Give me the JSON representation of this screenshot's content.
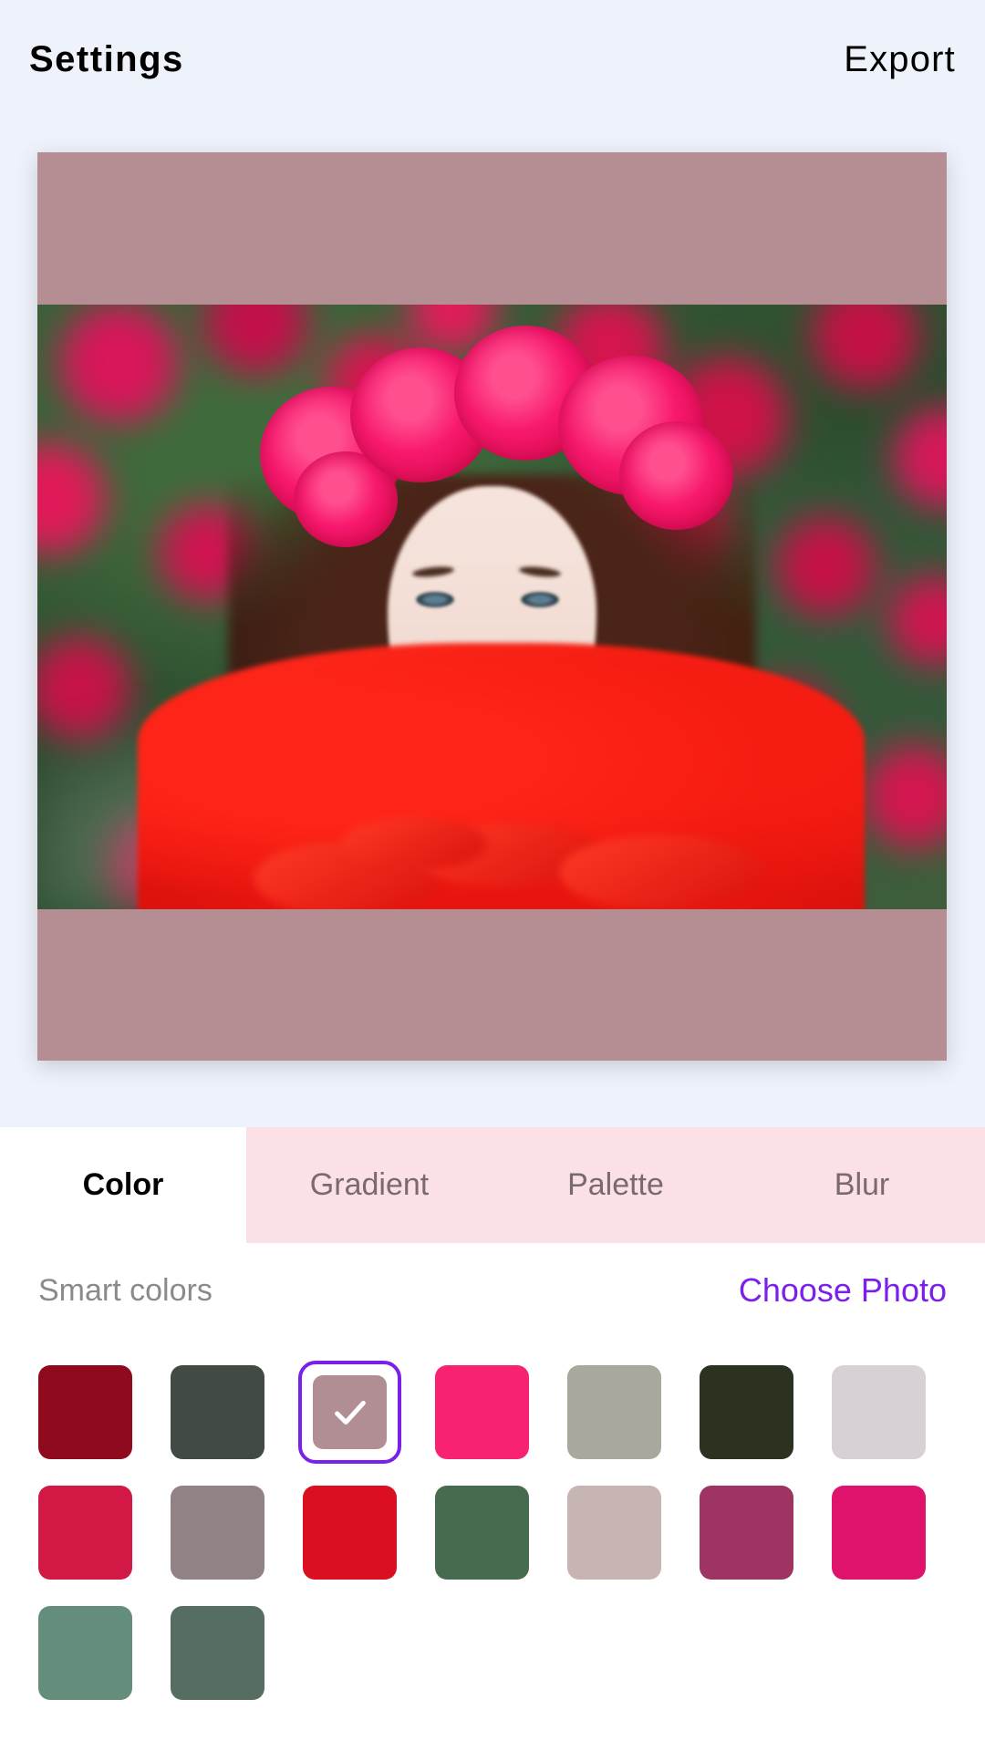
{
  "header": {
    "title": "Settings",
    "export_label": "Export"
  },
  "preview": {
    "background_color": "#b58e93",
    "photo_description": "Woman wearing a pink rose flower crown and a red ruffled dress in front of a blurred rose bush"
  },
  "tabs": [
    {
      "label": "Color",
      "active": true
    },
    {
      "label": "Gradient",
      "active": false
    },
    {
      "label": "Palette",
      "active": false
    },
    {
      "label": "Blur",
      "active": false
    }
  ],
  "panel": {
    "section_label": "Smart colors",
    "choose_photo_label": "Choose Photo",
    "accent_color": "#7b20ea",
    "selected_index": 2,
    "swatches": [
      {
        "color": "#8f0a1d",
        "selected": false
      },
      {
        "color": "#414b44",
        "selected": false
      },
      {
        "color": "#b18e93",
        "selected": true
      },
      {
        "color": "#f92272",
        "selected": false
      },
      {
        "color": "#a9a89c",
        "selected": false
      },
      {
        "color": "#2b3320",
        "selected": false
      },
      {
        "color": "#d7d0d4",
        "selected": false
      },
      {
        "color": "#d21945",
        "selected": false
      },
      {
        "color": "#918383",
        "selected": false
      },
      {
        "color": "#db0f21",
        "selected": false
      },
      {
        "color": "#466b4e",
        "selected": false
      },
      {
        "color": "#c6b5b2",
        "selected": false
      },
      {
        "color": "#9e3461",
        "selected": false
      },
      {
        "color": "#e0136c",
        "selected": false
      },
      {
        "color": "#648e7b",
        "selected": false
      },
      {
        "color": "#566e62",
        "selected": false
      }
    ]
  }
}
